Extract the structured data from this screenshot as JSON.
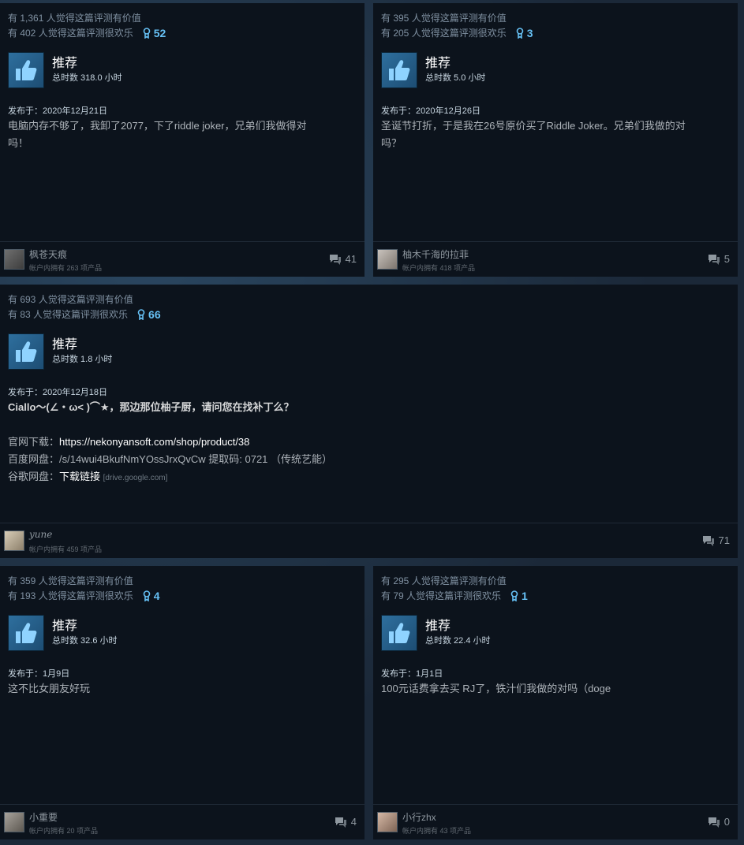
{
  "reviews": [
    {
      "helpful": "有 1,361 人觉得这篇评测有价值",
      "funny": "有 402 人觉得这篇评测很欢乐",
      "awards": "52",
      "recommend": "推荐",
      "hours": "总时数 318.0 小时",
      "date": "发布于：2020年12月21日",
      "lines": [
        "电脑内存不够了，我卸了2077，下了riddle joker，兄弟们我做得对",
        "吗！"
      ],
      "author": "枫苍天痕",
      "games": "帐户内拥有 263 项产品",
      "comments": "41"
    },
    {
      "helpful": "有 395 人觉得这篇评测有价值",
      "funny": "有 205 人觉得这篇评测很欢乐",
      "awards": "3",
      "recommend": "推荐",
      "hours": "总时数 5.0 小时",
      "date": "发布于：2020年12月26日",
      "lines": [
        "圣诞节打折，于是我在26号原价买了Riddle Joker。兄弟们我做的对",
        "吗？"
      ],
      "author": "柚木千海的拉菲",
      "games": "帐户内拥有 418 项产品",
      "comments": "5"
    },
    {
      "helpful": "有 693 人觉得这篇评测有价值",
      "funny": "有 83 人觉得这篇评测很欢乐",
      "awards": "66",
      "recommend": "推荐",
      "hours": "总时数 1.8 小时",
      "date": "发布于：2020年12月18日",
      "line1": "Ciallo～(∠・ω< )⌒★，那边那位柚子厨，请问您在找补丁么？",
      "official_label": "官网下载：",
      "official_link": "https://nekonyansoft.com/shop/product/38",
      "baidu": "百度网盘：/s/14wui4BkufNmYOssJrxQvCw 提取码: 0721 （传统艺能）",
      "google_label": "谷歌网盘：",
      "google_link": "下载链接",
      "google_hint": "[drive.google.com]",
      "author": "yune",
      "games": "帐户内拥有 459 项产品",
      "comments": "71"
    },
    {
      "helpful": "有 359 人觉得这篇评测有价值",
      "funny": "有 193 人觉得这篇评测很欢乐",
      "awards": "4",
      "recommend": "推荐",
      "hours": "总时数 32.6 小时",
      "date": "发布于：1月9日",
      "lines": [
        "这不比女朋友好玩"
      ],
      "author": "小重要",
      "games": "帐户内拥有 20 项产品",
      "comments": "4"
    },
    {
      "helpful": "有 295 人觉得这篇评测有价值",
      "funny": "有 79 人觉得这篇评测很欢乐",
      "awards": "1",
      "recommend": "推荐",
      "hours": "总时数 22.4 小时",
      "date": "发布于：1月1日",
      "lines": [
        "100元话费拿去买 RJ了，铁汁们我做的对吗（doge"
      ],
      "author": "小行zhx",
      "games": "帐户内拥有 43 项产品",
      "comments": "0"
    }
  ],
  "colors": {
    "accent": "#66c0f4",
    "card_bg": "#0c131c",
    "page_bg": "#1b2838"
  }
}
